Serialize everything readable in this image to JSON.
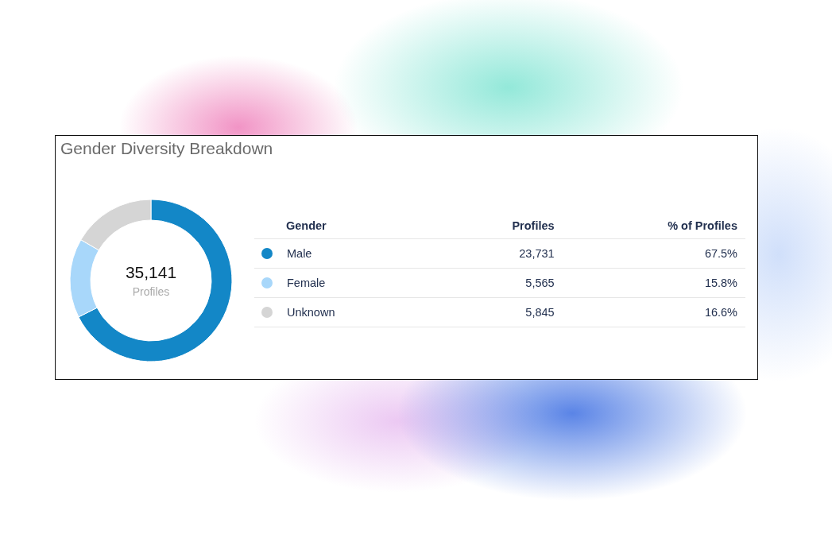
{
  "title": "Gender Diversity Breakdown",
  "donut": {
    "total": "35,141",
    "total_label": "Profiles",
    "chart_data": {
      "type": "donut",
      "values": [
        67.5,
        15.8,
        16.6
      ]
    }
  },
  "table": {
    "columns": [
      "Gender",
      "Profiles",
      "% of Profiles"
    ],
    "rows": [
      {
        "gender": "Male",
        "profiles": "23,731",
        "percent": "67.5%",
        "color": "#1387c7"
      },
      {
        "gender": "Female",
        "profiles": "5,565",
        "percent": "15.8%",
        "color": "#a8d7fa"
      },
      {
        "gender": "Unknown",
        "profiles": "5,845",
        "percent": "16.6%",
        "color": "#d5d5d5"
      }
    ]
  }
}
